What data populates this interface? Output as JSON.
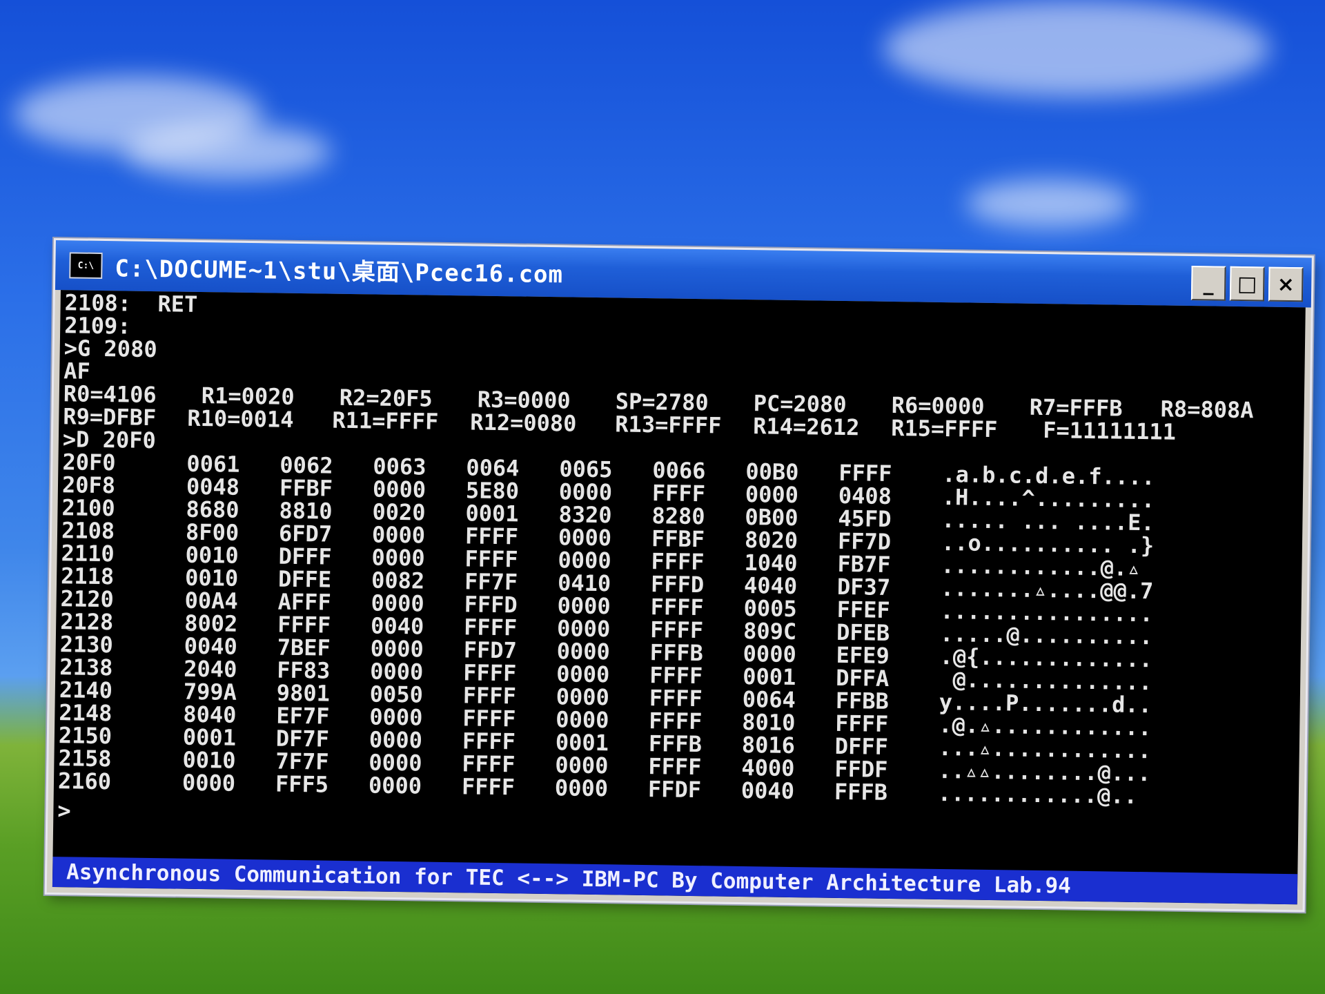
{
  "window": {
    "title": "C:\\DOCUME~1\\stu\\桌面\\Pcec16.com",
    "icon_text": "C:\\",
    "buttons": {
      "minimize": "_",
      "maximize": "□",
      "close": "×"
    }
  },
  "console": {
    "history": [
      "2108:  RET",
      "2109:",
      ">G 2080",
      "AF"
    ],
    "registers_row1": [
      "R0=4106",
      "R1=0020",
      "R2=20F5",
      "R3=0000",
      "SP=2780",
      "PC=2080",
      "R6=0000",
      "R7=FFFB",
      "R8=808A"
    ],
    "registers_row2": [
      "R9=DFBF",
      "R10=0014",
      "R11=FFFF",
      "R12=0080",
      "R13=FFFF",
      "R14=2612",
      "R15=FFFF",
      "F=11111111"
    ],
    "dump_command": ">D 20F0",
    "dump_rows": [
      {
        "addr": "20F0",
        "words": [
          "0061",
          "0062",
          "0063",
          "0064",
          "0065",
          "0066",
          "00B0",
          "FFFF"
        ],
        "ascii": ".a.b.c.d.e.f...."
      },
      {
        "addr": "20F8",
        "words": [
          "0048",
          "FFBF",
          "0000",
          "5E80",
          "0000",
          "FFFF",
          "0000",
          "0408"
        ],
        "ascii": ".H....^........."
      },
      {
        "addr": "2100",
        "words": [
          "8680",
          "8810",
          "0020",
          "0001",
          "8320",
          "8280",
          "0B00",
          "45FD"
        ],
        "ascii": "..... ... ....E."
      },
      {
        "addr": "2108",
        "words": [
          "8F00",
          "6FD7",
          "0000",
          "FFFF",
          "0000",
          "FFBF",
          "8020",
          "FF7D"
        ],
        "ascii": "..o.......... .}"
      },
      {
        "addr": "2110",
        "words": [
          "0010",
          "DFFF",
          "0000",
          "FFFF",
          "0000",
          "FFFF",
          "1040",
          "FB7F"
        ],
        "ascii": "............@.▵"
      },
      {
        "addr": "2118",
        "words": [
          "0010",
          "DFFE",
          "0082",
          "FF7F",
          "0410",
          "FFFD",
          "4040",
          "DF37"
        ],
        "ascii": ".......▵....@@.7"
      },
      {
        "addr": "2120",
        "words": [
          "00A4",
          "AFFF",
          "0000",
          "FFFD",
          "0000",
          "FFFF",
          "0005",
          "FFEF"
        ],
        "ascii": "................"
      },
      {
        "addr": "2128",
        "words": [
          "8002",
          "FFFF",
          "0040",
          "FFFF",
          "0000",
          "FFFF",
          "809C",
          "DFEB"
        ],
        "ascii": ".....@.........."
      },
      {
        "addr": "2130",
        "words": [
          "0040",
          "7BEF",
          "0000",
          "FFD7",
          "0000",
          "FFFB",
          "0000",
          "EFE9"
        ],
        "ascii": ".@{............."
      },
      {
        "addr": "2138",
        "words": [
          "2040",
          "FF83",
          "0000",
          "FFFF",
          "0000",
          "FFFF",
          "0001",
          "DFFA"
        ],
        "ascii": " @.............."
      },
      {
        "addr": "2140",
        "words": [
          "799A",
          "9801",
          "0050",
          "FFFF",
          "0000",
          "FFFF",
          "0064",
          "FFBB"
        ],
        "ascii": "y....P.......d.."
      },
      {
        "addr": "2148",
        "words": [
          "8040",
          "EF7F",
          "0000",
          "FFFF",
          "0000",
          "FFFF",
          "8010",
          "FFFF"
        ],
        "ascii": ".@.▵............"
      },
      {
        "addr": "2150",
        "words": [
          "0001",
          "DF7F",
          "0000",
          "FFFF",
          "0001",
          "FFFB",
          "8016",
          "DFFF"
        ],
        "ascii": "...▵............"
      },
      {
        "addr": "2158",
        "words": [
          "0010",
          "7F7F",
          "0000",
          "FFFF",
          "0000",
          "FFFF",
          "4000",
          "FFDF"
        ],
        "ascii": "..▵▵........@..."
      },
      {
        "addr": "2160",
        "words": [
          "0000",
          "FFF5",
          "0000",
          "FFFF",
          "0000",
          "FFDF",
          "0040",
          "FFFB"
        ],
        "ascii": "............@.."
      }
    ],
    "prompt": ">"
  },
  "statusbar": "Asynchronous Communication for TEC <--> IBM-PC By Computer Architecture Lab.94"
}
